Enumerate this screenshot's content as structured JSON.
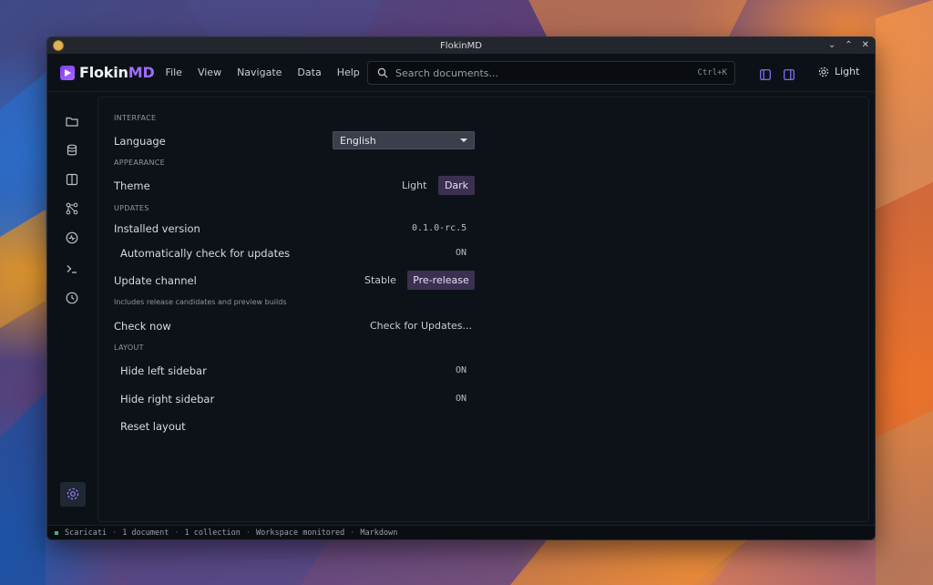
{
  "window": {
    "title": "FlokinMD"
  },
  "app": {
    "logo_main": "Flokin",
    "logo_accent": "MD"
  },
  "menu": [
    "File",
    "View",
    "Navigate",
    "Data",
    "Help"
  ],
  "search": {
    "placeholder": "Search documents...",
    "shortcut": "Ctrl+K"
  },
  "theme_toggle": {
    "label": "Light",
    "icon": "gear-icon"
  },
  "rail_icons": [
    "folder-icon",
    "database-icon",
    "split-panel-icon",
    "graph-icon",
    "activity-icon",
    "terminal-icon",
    "clock-icon",
    "settings-icon"
  ],
  "settings": {
    "interface": {
      "title": "INTERFACE",
      "language_label": "Language",
      "language_value": "English"
    },
    "appearance": {
      "title": "APPEARANCE",
      "theme_label": "Theme",
      "theme_options": [
        "Light",
        "Dark"
      ],
      "theme_selected": "Dark"
    },
    "updates": {
      "title": "UPDATES",
      "installed_label": "Installed version",
      "installed_value": "0.1.0-rc.5",
      "auto_check_label": "Automatically check for updates",
      "auto_check_value": "ON",
      "channel_label": "Update channel",
      "channel_options": [
        "Stable",
        "Pre-release"
      ],
      "channel_selected": "Pre-release",
      "channel_help": "Includes release candidates and preview builds",
      "check_label": "Check now",
      "check_button": "Check for Updates..."
    },
    "layout": {
      "title": "LAYOUT",
      "hide_left_label": "Hide left sidebar",
      "hide_left_value": "ON",
      "hide_right_label": "Hide right sidebar",
      "hide_right_value": "ON",
      "reset_label": "Reset layout"
    }
  },
  "status": {
    "workspace": "Scaricati",
    "documents": "1 document",
    "collections": "1 collection",
    "monitor": "Workspace monitored",
    "mode": "Markdown",
    "indicator_color": "#3fb37f"
  },
  "colors": {
    "accent": "#a06cff",
    "selected_bg": "#3c3051"
  }
}
